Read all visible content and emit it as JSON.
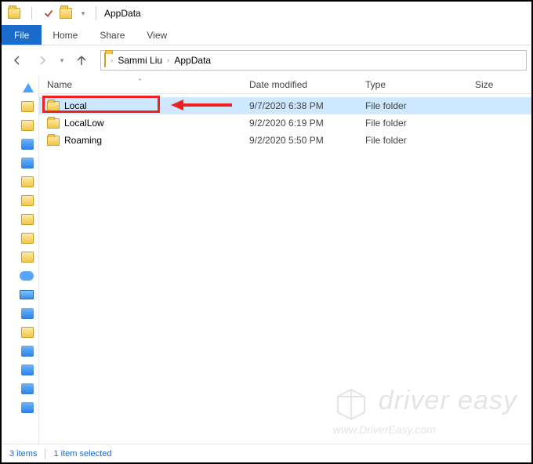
{
  "window": {
    "title": "AppData"
  },
  "ribbon": {
    "file_label": "File",
    "tabs": [
      "Home",
      "Share",
      "View"
    ]
  },
  "breadcrumb": {
    "segments": [
      "Sammi Liu",
      "AppData"
    ]
  },
  "columns": {
    "name": "Name",
    "date": "Date modified",
    "type": "Type",
    "size": "Size"
  },
  "items": [
    {
      "name": "Local",
      "date": "9/7/2020 6:38 PM",
      "type": "File folder",
      "selected": true
    },
    {
      "name": "LocalLow",
      "date": "9/2/2020 6:19 PM",
      "type": "File folder",
      "selected": false
    },
    {
      "name": "Roaming",
      "date": "9/2/2020 5:50 PM",
      "type": "File folder",
      "selected": false
    }
  ],
  "status": {
    "count": "3 items",
    "selection": "1 item selected"
  },
  "watermark": {
    "brand": "driver easy",
    "url": "www.DriverEasy.com"
  }
}
